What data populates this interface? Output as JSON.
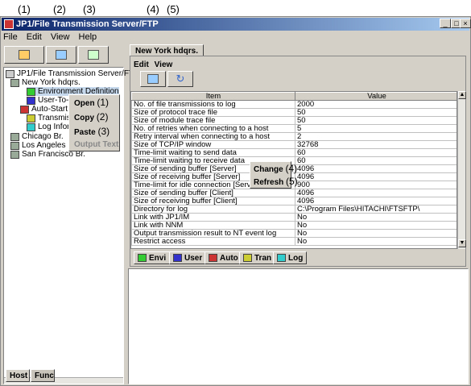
{
  "callouts": {
    "c1": "(1)",
    "c2": "(2)",
    "c3": "(3)",
    "c4": "(4)",
    "c5": "(5)"
  },
  "window": {
    "title": "JP1/File Transmission Server/FTP",
    "minimize": "_",
    "maximize": "□",
    "close": "×"
  },
  "menu": {
    "file": "File",
    "edit": "Edit",
    "view": "View",
    "help": "Help"
  },
  "tree": {
    "root": "JP1/File Transmission Server/FTP",
    "host1": "New York hdqrs.",
    "env": "Environment Definition",
    "user": "User-To-Lo",
    "auto": "Auto-Start F",
    "trans": "Transmissi",
    "log": "Log Inform",
    "host2": "Chicago Br.",
    "host3": "Los Angeles Br.",
    "host4": "San Francisco Br."
  },
  "ctx_left": {
    "open": "Open",
    "copy": "Copy",
    "paste": "Paste",
    "output": "Output Text",
    "n1": "(1)",
    "n2": "(2)",
    "n3": "(3)"
  },
  "left_tabs": {
    "host": "Host",
    "func": "Func"
  },
  "right": {
    "tab": "New York hdqrs.",
    "menu_edit": "Edit",
    "menu_view": "View",
    "col_item": "Item",
    "col_value": "Value",
    "rows": [
      {
        "item": "No. of file transmissions to log",
        "value": "2000"
      },
      {
        "item": "Size of protocol trace file",
        "value": "50"
      },
      {
        "item": "Size of module trace file",
        "value": "50"
      },
      {
        "item": "No. of retries when connecting to a host",
        "value": "5"
      },
      {
        "item": "Retry interval when connecting to a host",
        "value": "2"
      },
      {
        "item": "Size of TCP/IP window",
        "value": "32768"
      },
      {
        "item": "Time-limit waiting to send data",
        "value": "60"
      },
      {
        "item": "Time-limit waiting to receive data",
        "value": "60"
      },
      {
        "item": "Size of sending buffer [Server]",
        "value": "4096"
      },
      {
        "item": "Size of receiving buffer [Server]",
        "value": "4096"
      },
      {
        "item": "Time-limit for idle connection [Server]",
        "value": "900"
      },
      {
        "item": "Size of sending buffer [Client]",
        "value": "4096"
      },
      {
        "item": "Size of receiving buffer [Client]",
        "value": "4096"
      },
      {
        "item": "Directory for log",
        "value": "C:\\Program Files\\HITACHI\\FTSFTP\\"
      },
      {
        "item": "Link with JP1/IM",
        "value": "No"
      },
      {
        "item": "Link with NNM",
        "value": "No"
      },
      {
        "item": "Output transmission result to NT event log",
        "value": "No"
      },
      {
        "item": "Restrict access",
        "value": "No"
      }
    ],
    "ctx": {
      "change": "Change",
      "refresh": "Refresh",
      "n4": "(4)",
      "n5": "(5)"
    },
    "btabs": {
      "envi": "Envi",
      "user": "User",
      "auto": "Auto",
      "tran": "Tran",
      "log": "Log"
    }
  }
}
